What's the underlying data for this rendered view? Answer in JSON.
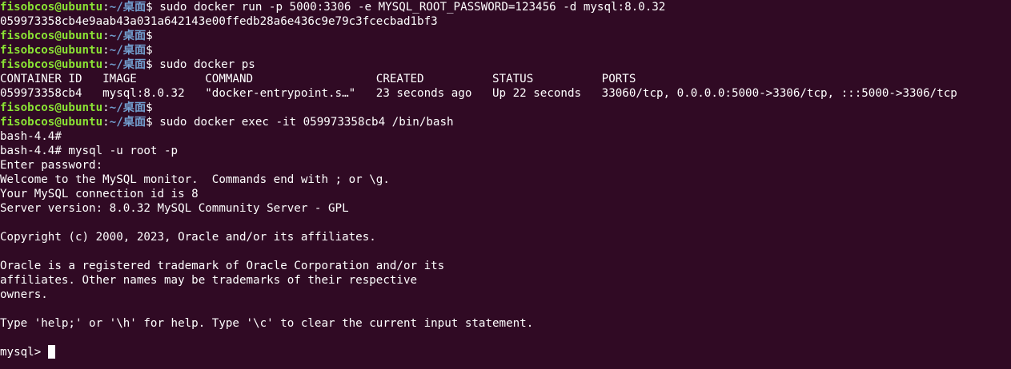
{
  "terminal": {
    "prompt_user": "fisobcos@ubuntu",
    "prompt_path": "~/桌面",
    "lines": [
      {
        "kind": "prompt",
        "cmd": "sudo docker run -p 5000:3306 -e MYSQL_ROOT_PASSWORD=123456 -d mysql:8.0.32"
      },
      {
        "kind": "out",
        "text": "059973358cb4e9aab43a031a642143e00ffedb28a6e436c9e79c3fcecbad1bf3"
      },
      {
        "kind": "prompt",
        "cmd": ""
      },
      {
        "kind": "prompt",
        "cmd": ""
      },
      {
        "kind": "prompt",
        "cmd": "sudo docker ps"
      },
      {
        "kind": "out",
        "text": "CONTAINER ID   IMAGE          COMMAND                  CREATED          STATUS          PORTS"
      },
      {
        "kind": "out",
        "text": "059973358cb4   mysql:8.0.32   \"docker-entrypoint.s…\"   23 seconds ago   Up 22 seconds   33060/tcp, 0.0.0.0:5000->3306/tcp, :::5000->3306/tcp"
      },
      {
        "kind": "prompt",
        "cmd": ""
      },
      {
        "kind": "prompt",
        "cmd": "sudo docker exec -it 059973358cb4 /bin/bash"
      },
      {
        "kind": "out",
        "text": "bash-4.4#"
      },
      {
        "kind": "out",
        "text": "bash-4.4# mysql -u root -p"
      },
      {
        "kind": "out",
        "text": "Enter password:"
      },
      {
        "kind": "out",
        "text": "Welcome to the MySQL monitor.  Commands end with ; or \\g."
      },
      {
        "kind": "out",
        "text": "Your MySQL connection id is 8"
      },
      {
        "kind": "out",
        "text": "Server version: 8.0.32 MySQL Community Server - GPL"
      },
      {
        "kind": "out",
        "text": ""
      },
      {
        "kind": "out",
        "text": "Copyright (c) 2000, 2023, Oracle and/or its affiliates."
      },
      {
        "kind": "out",
        "text": ""
      },
      {
        "kind": "out",
        "text": "Oracle is a registered trademark of Oracle Corporation and/or its"
      },
      {
        "kind": "out",
        "text": "affiliates. Other names may be trademarks of their respective"
      },
      {
        "kind": "out",
        "text": "owners."
      },
      {
        "kind": "out",
        "text": ""
      },
      {
        "kind": "out",
        "text": "Type 'help;' or '\\h' for help. Type '\\c' to clear the current input statement."
      },
      {
        "kind": "out",
        "text": ""
      },
      {
        "kind": "input",
        "text": "mysql> "
      }
    ],
    "colors": {
      "background": "#300a24",
      "foreground": "#ffffff",
      "user": "#8ae234",
      "path": "#729fcf"
    }
  }
}
